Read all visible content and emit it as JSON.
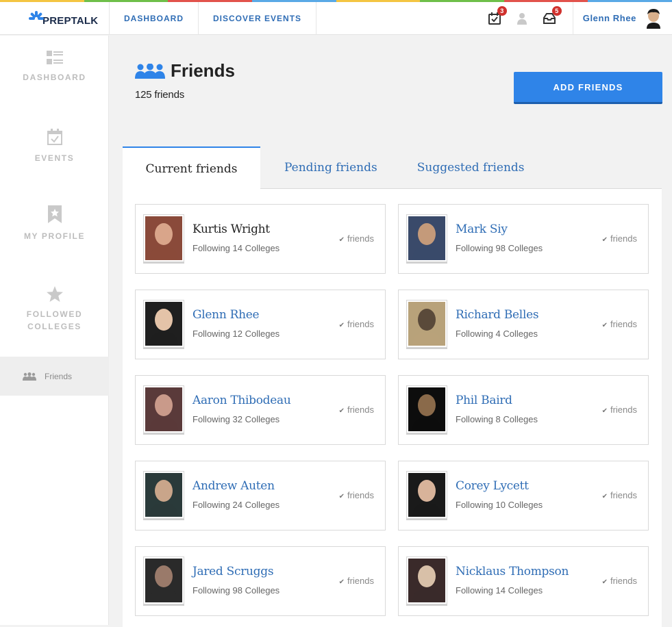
{
  "app": {
    "logo_text": "PREPTALK",
    "brand_color": "#2f84e8",
    "stripe_colors": [
      "#f4c542",
      "#6fbf4a",
      "#e2534c",
      "#5aa9e6",
      "#f4c542",
      "#6fbf4a",
      "#e2534c",
      "#5aa9e6"
    ]
  },
  "topnav": {
    "links": [
      {
        "label": "DASHBOARD",
        "name": "nav-dashboard"
      },
      {
        "label": "DISCOVER EVENTS",
        "name": "nav-discover-events"
      }
    ],
    "icons": [
      {
        "icon": "calendar-check-icon",
        "badge": "3"
      },
      {
        "icon": "person-icon",
        "badge": ""
      },
      {
        "icon": "inbox-icon",
        "badge": "5"
      }
    ],
    "user_name": "Glenn Rhee"
  },
  "sidebar": {
    "items": [
      {
        "label": "DASHBOARD",
        "icon": "dashboard-icon"
      },
      {
        "label": "EVENTS",
        "icon": "calendar-icon"
      },
      {
        "label": "MY PROFILE",
        "icon": "bookmark-icon"
      },
      {
        "label": "FOLLOWED\nCOLLEGES",
        "icon": "star-icon"
      }
    ],
    "friends_label": "Friends"
  },
  "page": {
    "title": "Friends",
    "friend_count": "125 friends",
    "add_button": "ADD FRIENDS"
  },
  "tabs": [
    {
      "label": "Current friends",
      "active": true
    },
    {
      "label": "Pending friends",
      "active": false
    },
    {
      "label": "Suggested friends",
      "active": false
    }
  ],
  "friends": [
    {
      "name": "Kurtis Wright",
      "following": "Following 14 Colleges",
      "status": "friends",
      "tone": [
        "#8a4a3a",
        "#d9a58a"
      ]
    },
    {
      "name": "Mark Siy",
      "following": "Following 98 Colleges",
      "status": "friends",
      "tone": [
        "#3a4a6a",
        "#c49a7a"
      ]
    },
    {
      "name": "Glenn Rhee",
      "following": "Following 12 Colleges",
      "status": "friends",
      "tone": [
        "#1f1f1f",
        "#e4c3a8"
      ]
    },
    {
      "name": "Richard Belles",
      "following": "Following 4 Colleges",
      "status": "friends",
      "tone": [
        "#b8a27a",
        "#5a4a3a"
      ]
    },
    {
      "name": "Aaron Thibodeau",
      "following": "Following 32 Colleges",
      "status": "friends",
      "tone": [
        "#5a3a3a",
        "#c99a8a"
      ]
    },
    {
      "name": "Phil Baird",
      "following": "Following 8 Colleges",
      "status": "friends",
      "tone": [
        "#0d0d0d",
        "#8a6a4a"
      ]
    },
    {
      "name": "Andrew Auten",
      "following": "Following 24 Colleges",
      "status": "friends",
      "tone": [
        "#2a3a3a",
        "#c9a58a"
      ]
    },
    {
      "name": "Corey Lycett",
      "following": "Following 10 Colleges",
      "status": "friends",
      "tone": [
        "#1a1a1a",
        "#d8b39a"
      ]
    },
    {
      "name": "Jared Scruggs",
      "following": "Following 98 Colleges",
      "status": "friends",
      "tone": [
        "#2a2a2a",
        "#9a7a6a"
      ]
    },
    {
      "name": "Nicklaus Thompson",
      "following": "Following 14 Colleges",
      "status": "friends",
      "tone": [
        "#3a2a2a",
        "#d8c0a8"
      ]
    }
  ]
}
